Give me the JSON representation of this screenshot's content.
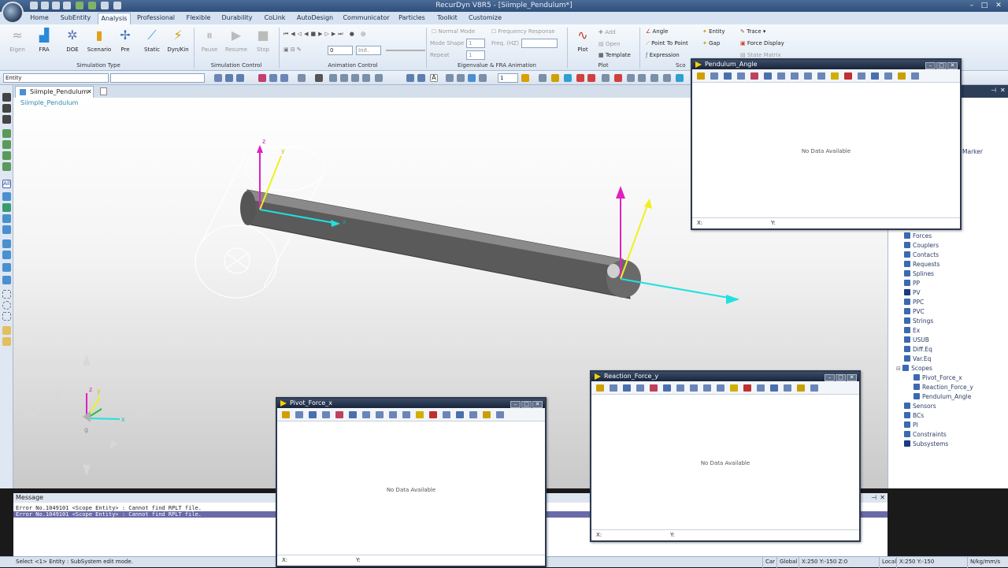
{
  "app": {
    "title": "RecurDyn V8R5 - [Siimple_Pendulum*]"
  },
  "tabs": [
    "Home",
    "SubEntity",
    "Analysis",
    "Professional",
    "Flexible",
    "Durability",
    "CoLink",
    "AutoDesign",
    "Communicator",
    "Particles",
    "Toolkit",
    "Customize"
  ],
  "ribbon": {
    "sim_type": {
      "label": "Simulation Type",
      "buttons": [
        "Eigen",
        "FRA",
        "DOE",
        "Scenario",
        "Pre",
        "Static",
        "Dyn/Kin"
      ]
    },
    "sim_control": {
      "label": "Simulation Control",
      "buttons": [
        "Pause",
        "Resume",
        "Stop"
      ]
    },
    "animation": {
      "label": "Animation Control",
      "frame_value": "0",
      "init_label": "Init."
    },
    "eigen": {
      "label": "Eigenvalue & FRA Animation",
      "normal_mode": "Normal Mode",
      "mode_shape": "Mode Shape",
      "mode_shape_value": "1",
      "repeat": "Repeat",
      "repeat_value": "1",
      "freq_response": "Frequency Response",
      "freq": "Freq. (HZ)"
    },
    "plot": {
      "label": "Plot",
      "plot_btn": "Plot",
      "add": "Add",
      "open": "Open",
      "template": "Template"
    },
    "scope": {
      "label": "Sco",
      "angle": "Angle",
      "point_to_point": "Point To Point",
      "expression": "Expression",
      "entity": "Entity",
      "gap": "Gap",
      "trace": "Trace",
      "force_display": "Force Display",
      "state_matrix": "State Matrix"
    }
  },
  "toolbar": {
    "entity_combo": "Entity",
    "page_value": "1"
  },
  "doc": {
    "tab": "Siimple_Pendulum",
    "model_label": "Siimple_Pendulum"
  },
  "viewport_labels": {
    "x": "x",
    "y": "y",
    "z": "z",
    "g": "g"
  },
  "tree": {
    "marker": "Marker",
    "items": [
      "Forces",
      "Couplers",
      "Contacts",
      "Requests",
      "Splines",
      "PP",
      "PV",
      "PPC",
      "PVC",
      "Strings",
      "Ex",
      "USUB",
      "Diff.Eq",
      "Var.Eq",
      "Scopes",
      "Pivot_Force_x",
      "Reaction_Force_y",
      "Pendulum_Angle",
      "Sensors",
      "BCs",
      "PI",
      "Constraints",
      "Subsystems"
    ]
  },
  "message": {
    "title": "Message",
    "lines": [
      "Error No.1049101 <Scope Entity> : Cannot find RPLT file.",
      "Error No.1049101 <Scope Entity> : Cannot find RPLT file."
    ]
  },
  "status": {
    "left": "Select <1> Entity : SubSystem edit mode.",
    "car": "Car",
    "global": "Global",
    "coords_global": "X:250 Y:-150 Z:0",
    "local": "Local",
    "coords_local": "X:250 Y:-150",
    "units": "N/kg/mm/s"
  },
  "scopes": {
    "angle": {
      "title": "Pendulum_Angle",
      "nodata": "No Data Available",
      "x": "X:",
      "y": "Y:"
    },
    "pivot": {
      "title": "Pivot_Force_x",
      "nodata": "No Data Available",
      "x": "X:",
      "y": "Y:"
    },
    "reaction": {
      "title": "Reaction_Force_y",
      "nodata": "No Data Available",
      "x": "X:",
      "y": "Y:"
    }
  }
}
